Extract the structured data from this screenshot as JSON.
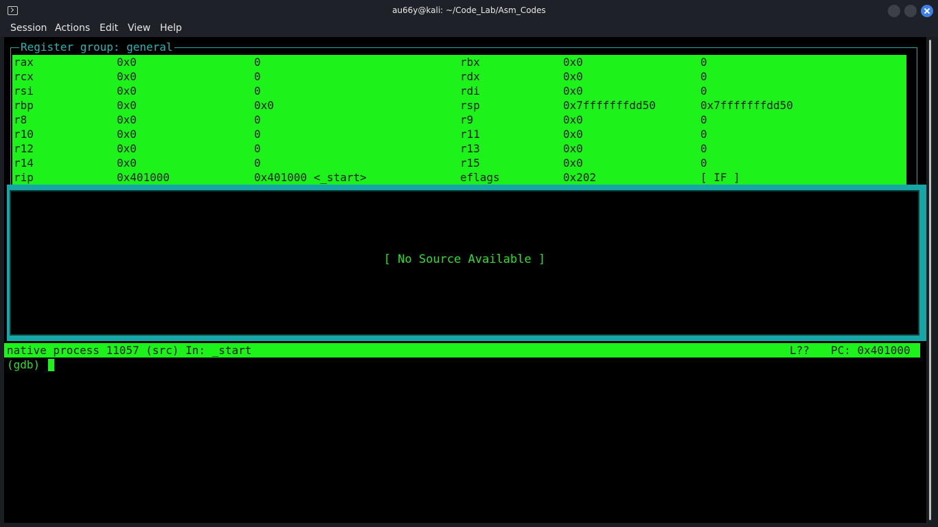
{
  "window": {
    "title": "au66y@kali: ~/Code_Lab/Asm_Codes"
  },
  "menu": [
    "Session",
    "Actions",
    "Edit",
    "View",
    "Help"
  ],
  "registers": {
    "group_title": "Register group: general",
    "rows": [
      {
        "n1": "rax",
        "h1": "0x0",
        "v1": "0",
        "n2": "rbx",
        "h2": "0x0",
        "v2": "0"
      },
      {
        "n1": "rcx",
        "h1": "0x0",
        "v1": "0",
        "n2": "rdx",
        "h2": "0x0",
        "v2": "0"
      },
      {
        "n1": "rsi",
        "h1": "0x0",
        "v1": "0",
        "n2": "rdi",
        "h2": "0x0",
        "v2": "0"
      },
      {
        "n1": "rbp",
        "h1": "0x0",
        "v1": "0x0",
        "n2": "rsp",
        "h2": "0x7fffffffdd50",
        "v2": "0x7fffffffdd50"
      },
      {
        "n1": "r8",
        "h1": "0x0",
        "v1": "0",
        "n2": "r9",
        "h2": "0x0",
        "v2": "0"
      },
      {
        "n1": "r10",
        "h1": "0x0",
        "v1": "0",
        "n2": "r11",
        "h2": "0x0",
        "v2": "0"
      },
      {
        "n1": "r12",
        "h1": "0x0",
        "v1": "0",
        "n2": "r13",
        "h2": "0x0",
        "v2": "0"
      },
      {
        "n1": "r14",
        "h1": "0x0",
        "v1": "0",
        "n2": "r15",
        "h2": "0x0",
        "v2": "0"
      },
      {
        "n1": "rip",
        "h1": "0x401000",
        "v1": "0x401000 <_start>",
        "n2": "eflags",
        "h2": "0x202",
        "v2": "[ IF ]"
      }
    ]
  },
  "source": {
    "message": "[ No Source Available ]"
  },
  "status": {
    "left": "native process 11057 (src) In: _start",
    "line": "L??",
    "pc": "PC: 0x401000"
  },
  "prompt": "(gdb) ",
  "colors": {
    "green": "#1df21a",
    "cyan": "#16a6a6",
    "terminal_bg": "#000000"
  }
}
